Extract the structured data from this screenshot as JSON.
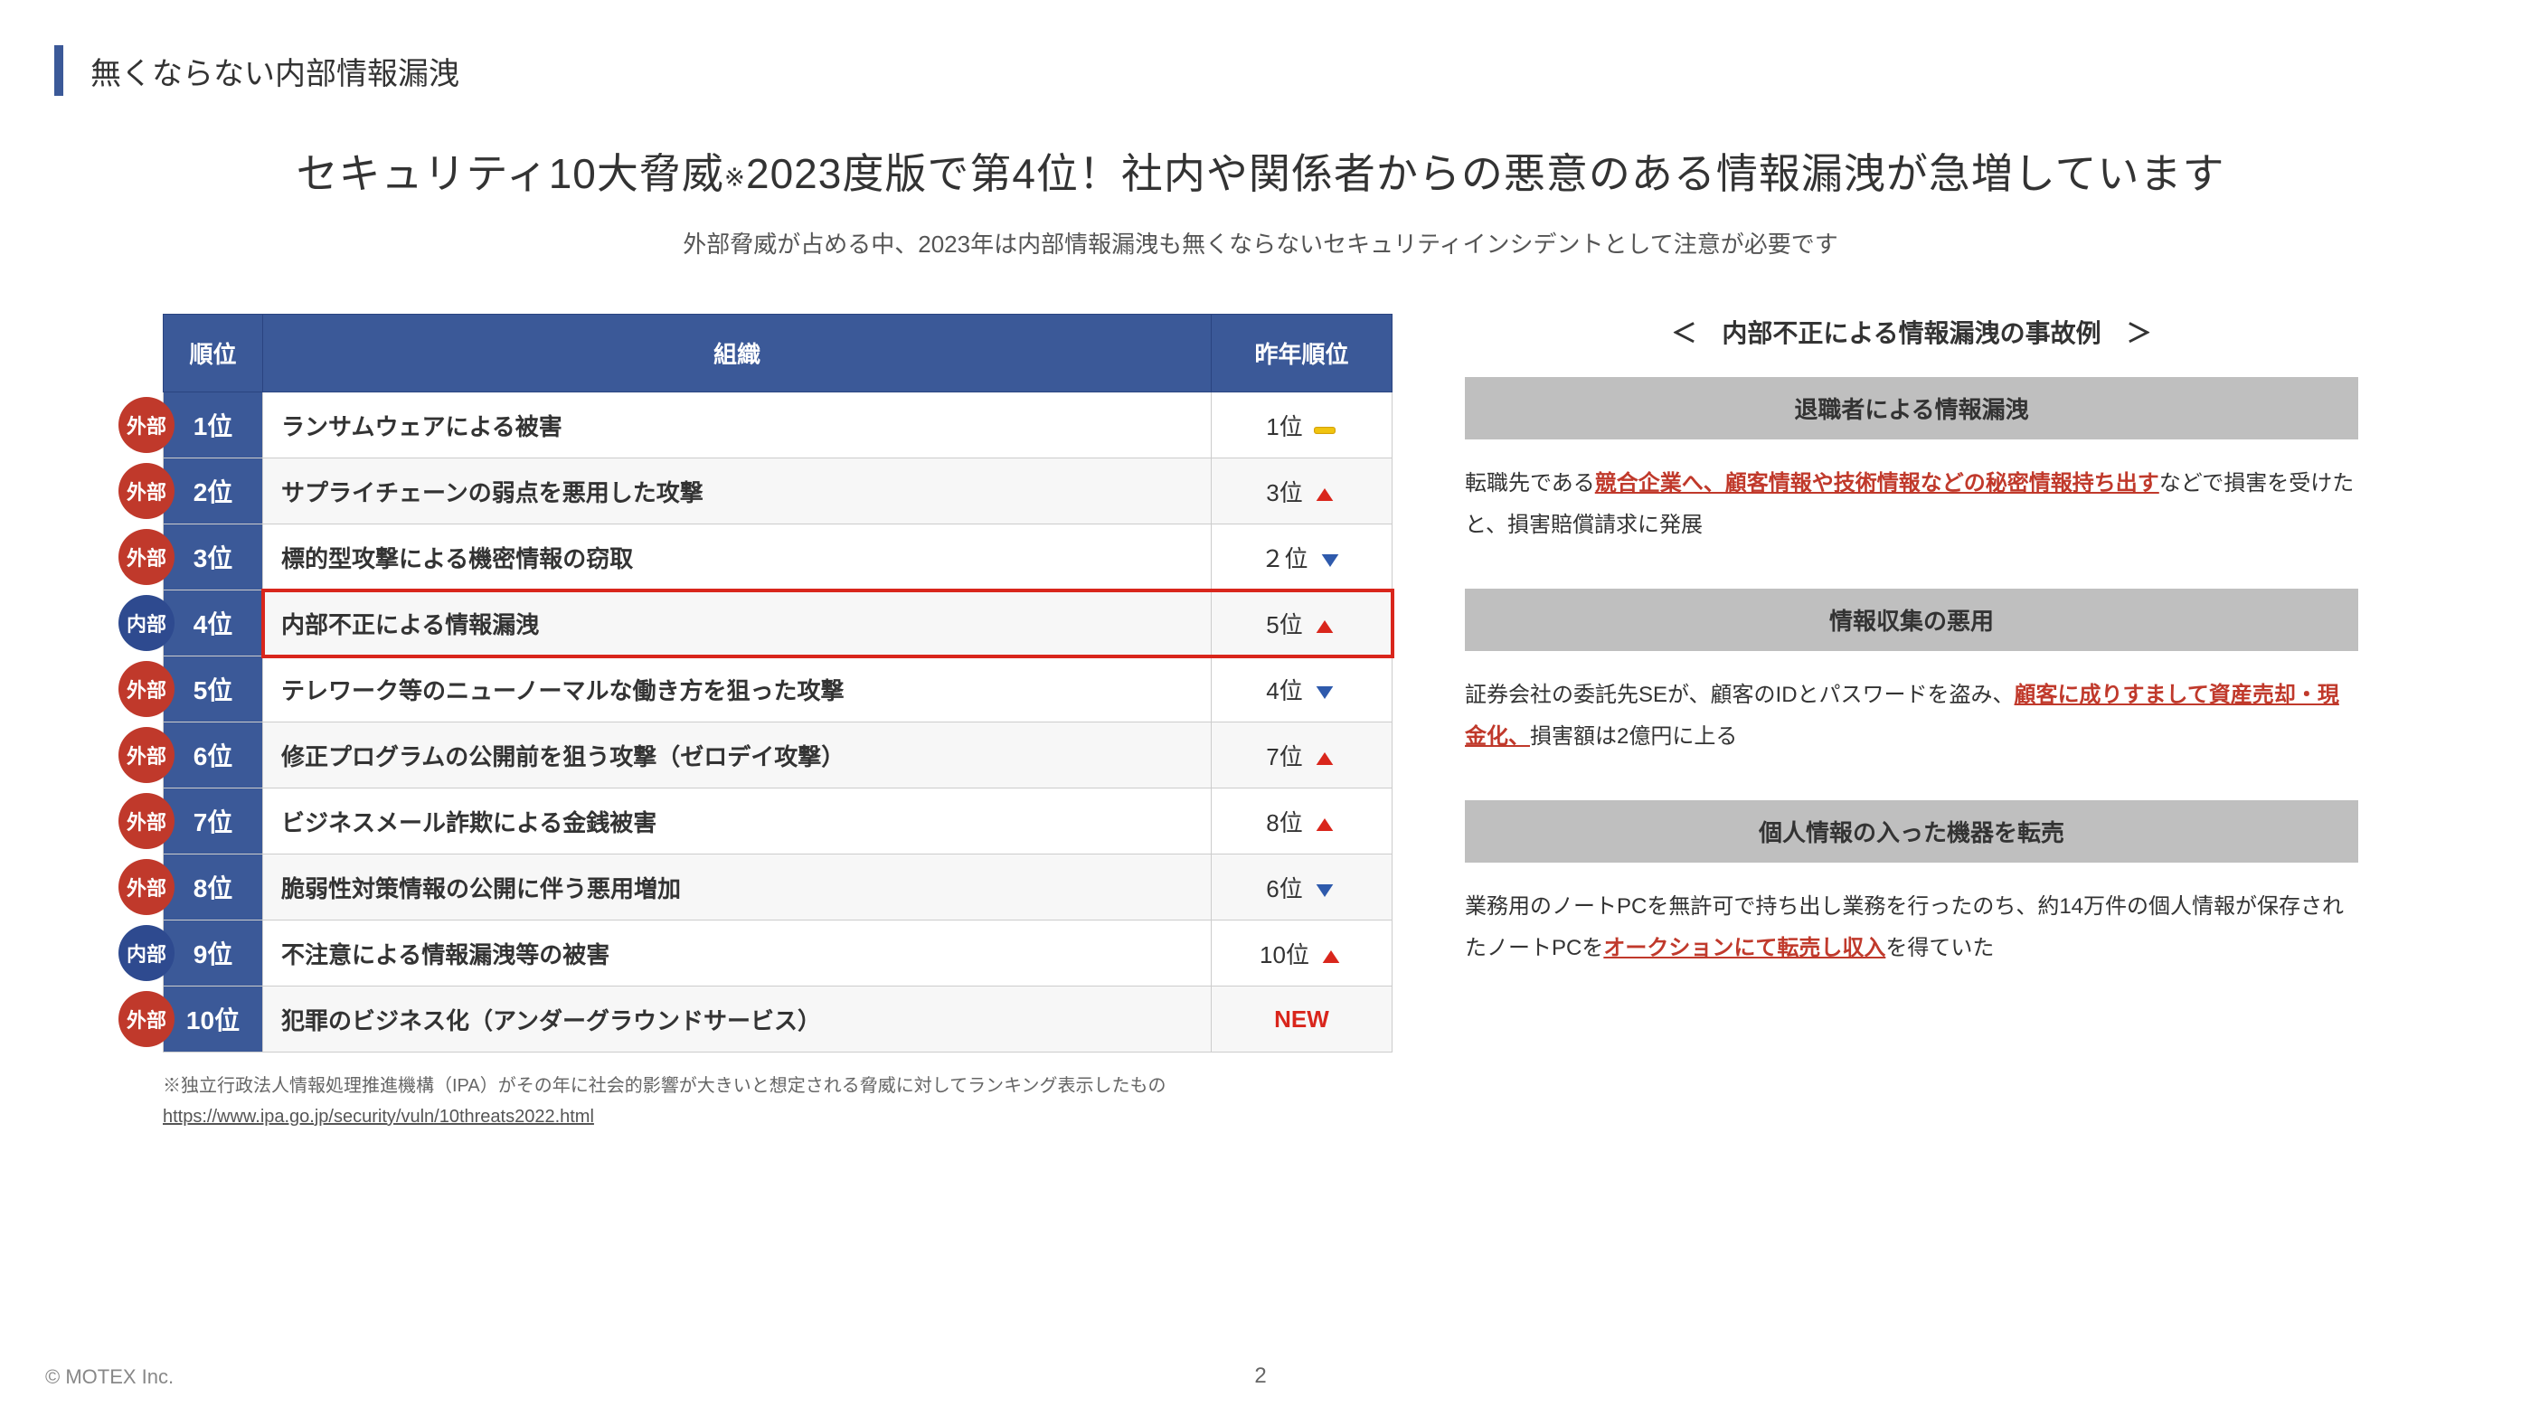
{
  "section_title": "無くならない内部情報漏洩",
  "main_title_pre": "セキュリティ10大脅威",
  "main_title_note": "※",
  "main_title_post": "2023度版で第4位！社内や関係者からの悪意のある情報漏洩が急増しています",
  "sub_title": "外部脅威が占める中、2023年は内部情報漏洩も無くならないセキュリティインシデントとして注意が必要です",
  "table": {
    "head_rank": "順位",
    "head_org": "組織",
    "head_prev": "昨年順位",
    "rows": [
      {
        "badge": "外部",
        "badge_type": "ext",
        "rank": "1位",
        "org": "ランサムウェアによる被害",
        "prev": "1位",
        "trend": "flat",
        "highlight": false
      },
      {
        "badge": "外部",
        "badge_type": "ext",
        "rank": "2位",
        "org": "サプライチェーンの弱点を悪用した攻撃",
        "prev": "3位",
        "trend": "up",
        "highlight": false
      },
      {
        "badge": "外部",
        "badge_type": "ext",
        "rank": "3位",
        "org": "標的型攻撃による機密情報の窃取",
        "prev": "２位",
        "trend": "down",
        "highlight": false
      },
      {
        "badge": "内部",
        "badge_type": "int",
        "rank": "4位",
        "org": "内部不正による情報漏洩",
        "prev": "5位",
        "trend": "up",
        "highlight": true
      },
      {
        "badge": "外部",
        "badge_type": "ext",
        "rank": "5位",
        "org": "テレワーク等のニューノーマルな働き方を狙った攻撃",
        "prev": "4位",
        "trend": "down",
        "highlight": false
      },
      {
        "badge": "外部",
        "badge_type": "ext",
        "rank": "6位",
        "org": "修正プログラムの公開前を狙う攻撃（ゼロデイ攻撃）",
        "prev": "7位",
        "trend": "up",
        "highlight": false
      },
      {
        "badge": "外部",
        "badge_type": "ext",
        "rank": "7位",
        "org": "ビジネスメール詐欺による金銭被害",
        "prev": "8位",
        "trend": "up",
        "highlight": false
      },
      {
        "badge": "外部",
        "badge_type": "ext",
        "rank": "8位",
        "org": "脆弱性対策情報の公開に伴う悪用増加",
        "prev": "6位",
        "trend": "down",
        "highlight": false
      },
      {
        "badge": "内部",
        "badge_type": "int",
        "rank": "9位",
        "org": "不注意による情報漏洩等の被害",
        "prev": "10位",
        "trend": "up",
        "highlight": false
      },
      {
        "badge": "外部",
        "badge_type": "ext",
        "rank": "10位",
        "org": "犯罪のビジネス化（アンダーグラウンドサービス）",
        "prev": "NEW",
        "trend": "new",
        "highlight": false
      }
    ]
  },
  "footnote_text": "※独立行政法人情報処理推進機構（IPA）がその年に社会的影響が大きいと想定される脅威に対してランキング表示したもの",
  "footnote_link": "https://www.ipa.go.jp/security/vuln/10threats2022.html",
  "right_title": "＜　内部不正による情報漏洩の事故例　＞",
  "cases": [
    {
      "header": "退職者による情報漏洩",
      "pre": "転職先である",
      "red": "競合企業へ、顧客情報や技術情報などの秘密情報持ち出す",
      "post": "などで損害を受けたと、損害賠償請求に発展"
    },
    {
      "header": "情報収集の悪用",
      "pre": "証券会社の委託先SEが、顧客のIDとパスワードを盗み、",
      "red": "顧客に成りすまして資産売却・現金化、",
      "post": "損害額は2億円に上る"
    },
    {
      "header": "個人情報の入った機器を転売",
      "pre": "業務用のノートPCを無許可で持ち出し業務を行ったのち、約14万件の個人情報が保存されたノートPCを",
      "red": "オークションにて転売し収入",
      "post": "を得ていた"
    }
  ],
  "footer": "© MOTEX Inc.",
  "page_num": "2"
}
